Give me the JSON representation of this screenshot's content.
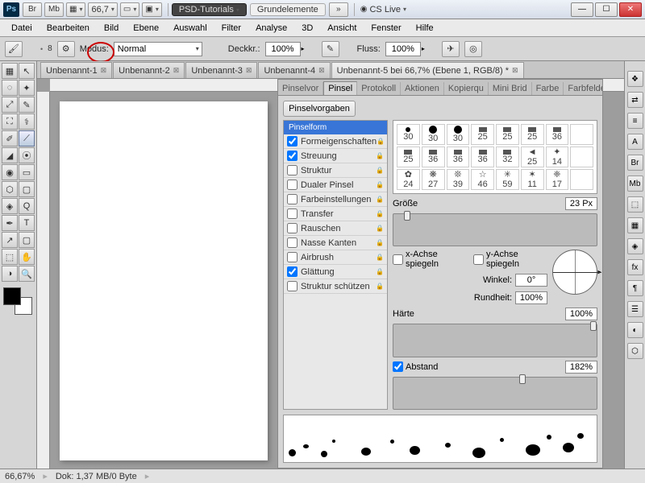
{
  "title": {
    "psd_tutorials": "PSD-Tutorials",
    "doc_name": "Grundelemente",
    "cs_live": "CS Live",
    "zoom_title": "66,7"
  },
  "menu": [
    "Datei",
    "Bearbeiten",
    "Bild",
    "Ebene",
    "Auswahl",
    "Filter",
    "Analyse",
    "3D",
    "Ansicht",
    "Fenster",
    "Hilfe"
  ],
  "options": {
    "size_num": "8",
    "modus_label": "Modus:",
    "modus_value": "Normal",
    "deckk_label": "Deckkr.:",
    "deckk_value": "100%",
    "fluss_label": "Fluss:",
    "fluss_value": "100%"
  },
  "doctabs": [
    {
      "label": "Unbenannt-1",
      "active": false
    },
    {
      "label": "Unbenannt-2",
      "active": false
    },
    {
      "label": "Unbenannt-3",
      "active": false
    },
    {
      "label": "Unbenannt-4",
      "active": false
    },
    {
      "label": "Unbenannt-5 bei 66,7% (Ebene 1, RGB/8) *",
      "active": true
    }
  ],
  "panel_tabs": [
    "Pinselvor",
    "Pinsel",
    "Protokoll",
    "Aktionen",
    "Kopierqu",
    "Mini Brid",
    "Farbe",
    "Farbfelde"
  ],
  "panel_active_tab": 1,
  "preset_button": "Pinselvorgaben",
  "attrs": [
    {
      "label": "Pinselform",
      "type": "head"
    },
    {
      "label": "Formeigenschaften",
      "checked": true,
      "lock": true
    },
    {
      "label": "Streuung",
      "checked": true,
      "lock": true
    },
    {
      "label": "Struktur",
      "checked": false,
      "lock": true
    },
    {
      "label": "Dualer Pinsel",
      "checked": false,
      "lock": true
    },
    {
      "label": "Farbeinstellungen",
      "checked": false,
      "lock": true
    },
    {
      "label": "Transfer",
      "checked": false,
      "lock": true
    },
    {
      "label": "Rauschen",
      "checked": false,
      "lock": true
    },
    {
      "label": "Nasse Kanten",
      "checked": false,
      "lock": true
    },
    {
      "label": "Airbrush",
      "checked": false,
      "lock": true
    },
    {
      "label": "Glättung",
      "checked": true,
      "lock": true
    },
    {
      "label": "Struktur schützen",
      "checked": false,
      "lock": true
    }
  ],
  "thumbs": [
    [
      ".",
      "30"
    ],
    [
      "●",
      "30"
    ],
    [
      "●",
      "30"
    ],
    [
      "▬",
      "25"
    ],
    [
      "▬",
      "25"
    ],
    [
      "▬",
      "25"
    ],
    [
      "▬",
      "36"
    ],
    [
      "",
      ""
    ],
    [
      "▬",
      "25"
    ],
    [
      "▬",
      "36"
    ],
    [
      "▬",
      "36"
    ],
    [
      "▬",
      "36"
    ],
    [
      "▬",
      "32"
    ],
    [
      "◄",
      "25"
    ],
    [
      "✦",
      "14"
    ],
    [
      "",
      ""
    ],
    [
      "✿",
      "24"
    ],
    [
      "❋",
      "27"
    ],
    [
      "❊",
      "39"
    ],
    [
      "☆",
      "46"
    ],
    [
      "✳",
      "59"
    ],
    [
      "✶",
      "11"
    ],
    [
      "❈",
      "17"
    ],
    [
      "",
      ""
    ]
  ],
  "controls": {
    "size_label": "Größe",
    "size_value": "23 Px",
    "flip_x": "x-Achse spiegeln",
    "flip_y": "y-Achse spiegeln",
    "angle_label": "Winkel:",
    "angle_value": "0°",
    "round_label": "Rundheit:",
    "round_value": "100%",
    "hard_label": "Härte",
    "hard_value": "100%",
    "spacing_label": "Abstand",
    "spacing_value": "182%"
  },
  "status": {
    "zoom": "66,67%",
    "doc_size": "Dok: 1,37 MB/0 Byte"
  },
  "tools": [
    "▦",
    "↖",
    "◌",
    "✦",
    "⤢",
    "✎",
    "⛶",
    "⚕",
    "✐",
    "⟋",
    "◢",
    "⦿",
    "◉",
    "▭",
    "⬡",
    "▢",
    "◈",
    "Q",
    "✒",
    "T",
    "↗",
    "▢",
    "⬚",
    "✋",
    "◑",
    "🔍"
  ],
  "dock_icons": [
    "❖",
    "⇄",
    "≡",
    "A",
    "Br",
    "Mb",
    "⬚",
    "▦",
    "◈",
    "fx",
    "¶",
    "☰",
    "◐",
    "⬡"
  ]
}
